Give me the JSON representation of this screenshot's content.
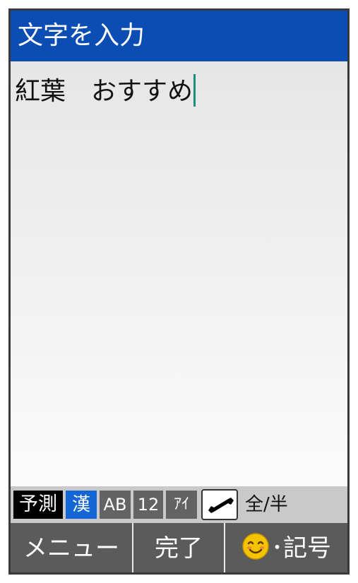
{
  "title": "文字を入力",
  "editor": {
    "text": "紅葉　おすすめ"
  },
  "modes": {
    "predict": "予測",
    "kanji": "漢",
    "alpha": "AB",
    "numeric": "12",
    "katakana": "ｱｲ",
    "width_toggle": "全/半"
  },
  "softkeys": {
    "menu": "メニュー",
    "done": "完了",
    "symbol": "･記号"
  },
  "colors": {
    "titlebar": "#0b4db3",
    "active_mode": "#1466d6",
    "caret": "#1a8f7a"
  }
}
